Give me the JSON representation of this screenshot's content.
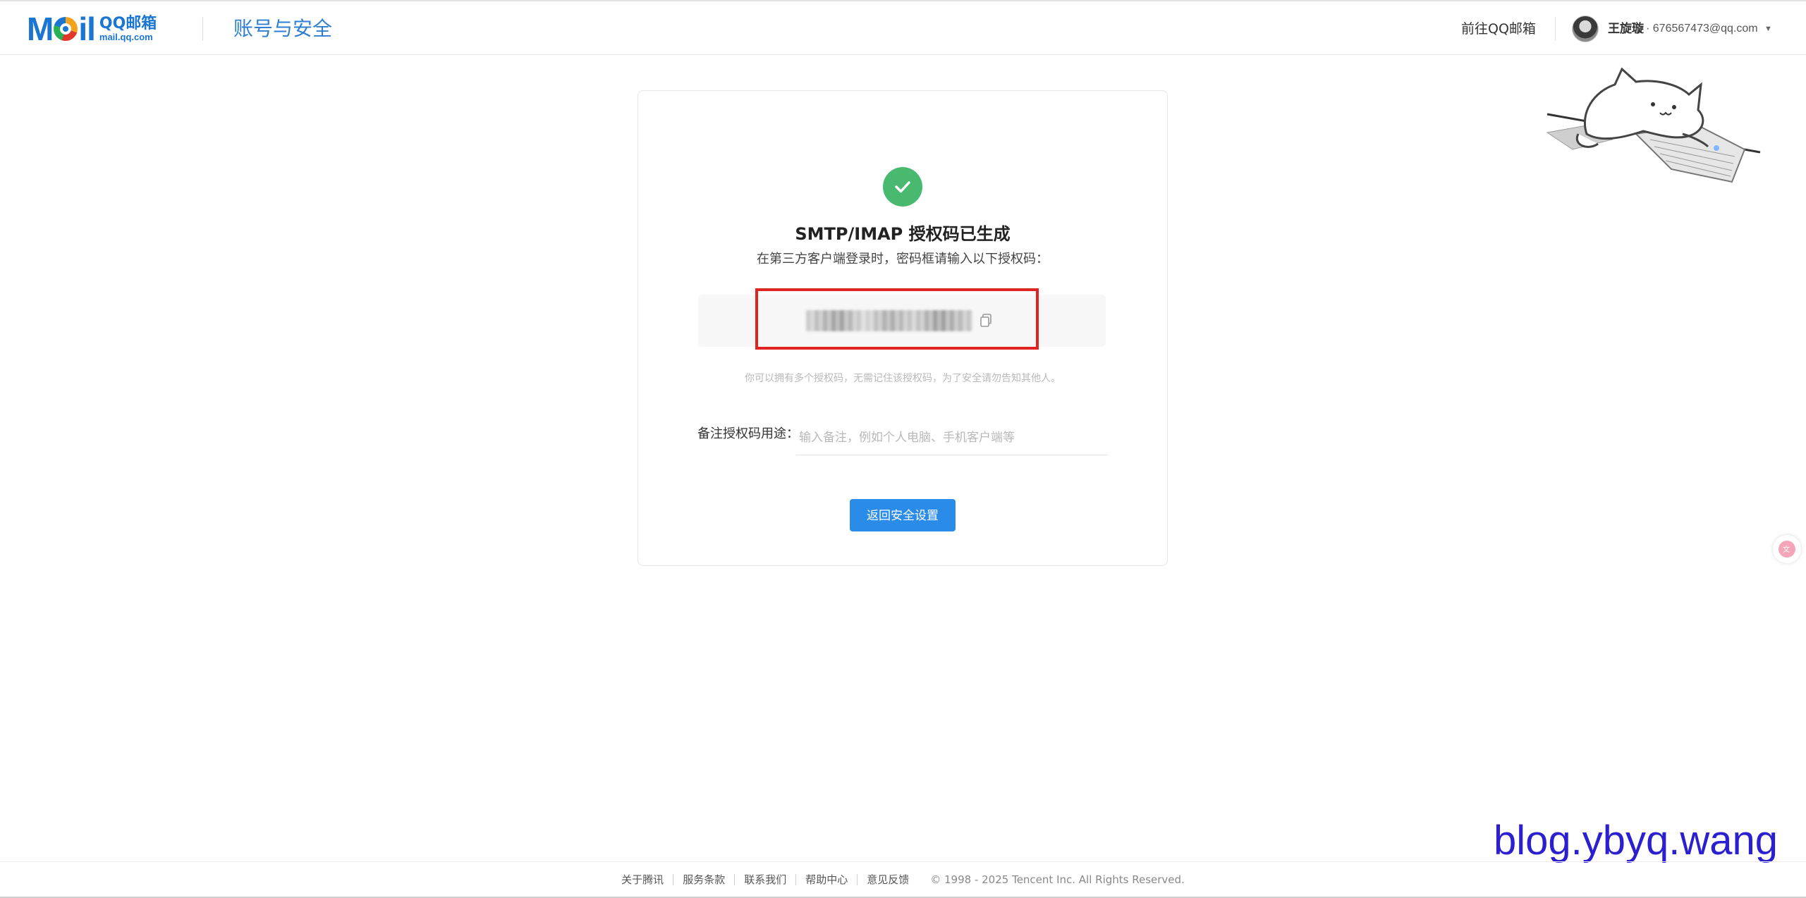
{
  "header": {
    "logo_brand": "QQ邮箱",
    "logo_domain": "mail.qq.com",
    "page_title": "账号与安全",
    "goto_mail": "前往QQ邮箱",
    "user_name": "王旋璇",
    "user_email": "· 676567473@qq.com",
    "caret": "▼"
  },
  "card": {
    "title": "SMTP/IMAP 授权码已生成",
    "subtitle": "在第三方客户端登录时，密码框请输入以下授权码：",
    "hint": "你可以拥有多个授权码，无需记住该授权码，为了安全请勿告知其他人。",
    "remark_label": "备注授权码用途：",
    "remark_placeholder": "输入备注，例如个人电脑、手机客户端等",
    "back_button": "返回安全设置"
  },
  "watermark": "blog.ybyq.wang",
  "footer": {
    "links": [
      "关于腾讯",
      "服务条款",
      "联系我们",
      "帮助中心",
      "意见反馈"
    ],
    "copyright": "© 1998 - 2025 Tencent Inc. All Rights Reserved."
  },
  "colors": {
    "accent": "#2b8be8",
    "success": "#49b970",
    "highlight_frame": "#e02424",
    "watermark": "#2b1fcf"
  }
}
